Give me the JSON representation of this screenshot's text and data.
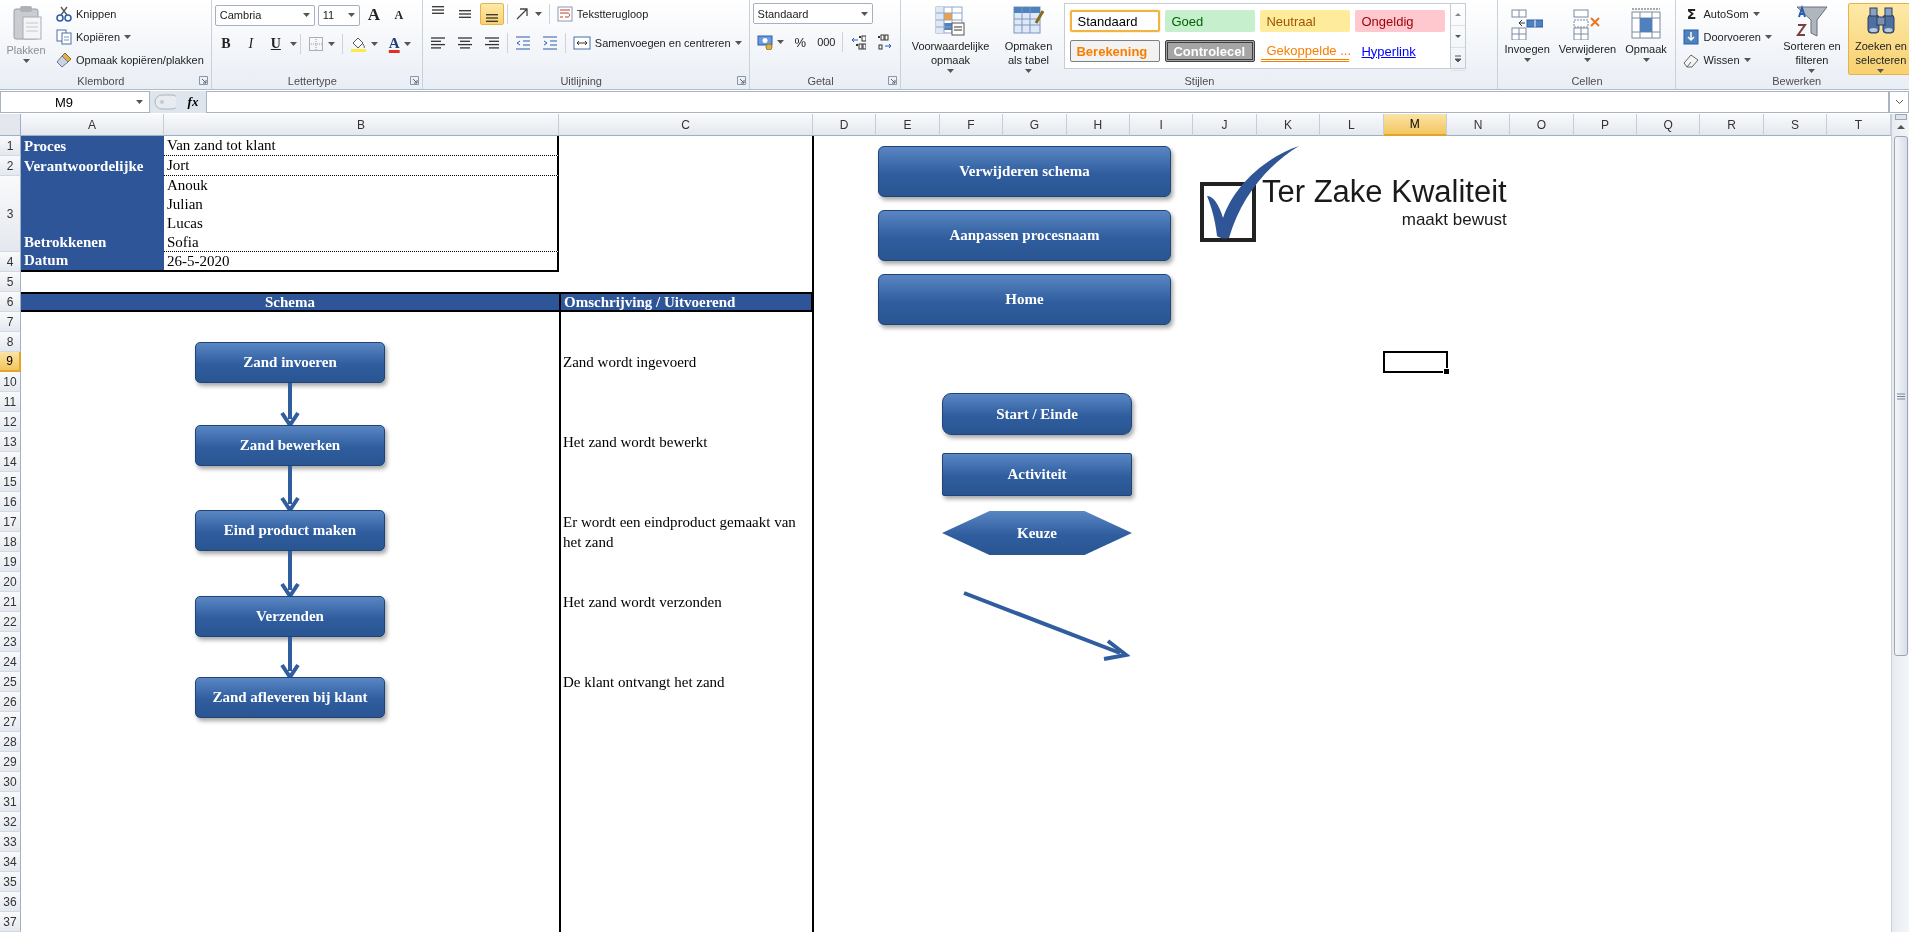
{
  "ribbon": {
    "groups": [
      {
        "kind": "clipboard",
        "label": "Klembord",
        "paste": "Plakken",
        "items": [
          "Knippen",
          "Kopiëren",
          "Opmaak kopiëren/plakken"
        ]
      },
      {
        "kind": "font",
        "label": "Lettertype",
        "font": "Cambria",
        "size": "11",
        "grow": "A",
        "shrink": "A",
        "styles": [
          "B",
          "I",
          "U"
        ],
        "font_color": "A"
      },
      {
        "kind": "alignment",
        "label": "Uitlijning",
        "vertical": [
          {
            "selected": false
          },
          {
            "selected": false
          },
          {
            "selected": true
          }
        ],
        "wrap": "Tekstterugloop",
        "merge": "Samenvoegen en centreren"
      },
      {
        "kind": "number",
        "label": "Getal",
        "format": "Standaard",
        "percent": "%",
        "thousands": "000"
      },
      {
        "kind": "styles",
        "label": "Stijlen",
        "buttons": [
          "Voorwaardelijke opmaak",
          "Opmaken als tabel"
        ],
        "cell_styles": [
          {
            "label": "Standaard",
            "kind": "normal",
            "selected": true
          },
          {
            "label": "Goed",
            "kind": "good",
            "selected": false
          },
          {
            "label": "Neutraal",
            "kind": "neutral",
            "selected": false
          },
          {
            "label": "Ongeldig",
            "kind": "bad",
            "selected": false
          },
          {
            "label": "Berekening",
            "kind": "calculation",
            "selected": false
          },
          {
            "label": "Controlecel",
            "kind": "check",
            "selected": false
          },
          {
            "label": "Gekoppelde ...",
            "kind": "linked",
            "selected": false
          },
          {
            "label": "Hyperlink",
            "kind": "hyperlink",
            "selected": false
          }
        ]
      },
      {
        "kind": "cells",
        "label": "Cellen",
        "buttons": [
          "Invoegen",
          "Verwijderen",
          "Opmaak"
        ]
      },
      {
        "kind": "editing",
        "label": "Bewerken",
        "items": [
          {
            "icon": "Σ",
            "label": "AutoSom"
          },
          {
            "label": "Doorvoeren"
          },
          {
            "label": "Wissen"
          }
        ],
        "buttons": [
          {
            "label": "Sorteren en filteren",
            "highlighted": false
          },
          {
            "label": "Zoeken en selecteren",
            "highlighted": true
          }
        ]
      }
    ]
  },
  "formula_bar": {
    "name_box": "M9",
    "fx": "fx"
  },
  "columns": [
    {
      "label": "A",
      "selected": false
    },
    {
      "label": "B",
      "selected": false
    },
    {
      "label": "C",
      "selected": false
    },
    {
      "label": "D",
      "selected": false
    },
    {
      "label": "E",
      "selected": false
    },
    {
      "label": "F",
      "selected": false
    },
    {
      "label": "G",
      "selected": false
    },
    {
      "label": "H",
      "selected": false
    },
    {
      "label": "I",
      "selected": false
    },
    {
      "label": "J",
      "selected": false
    },
    {
      "label": "K",
      "selected": false
    },
    {
      "label": "L",
      "selected": false
    },
    {
      "label": "M",
      "selected": true
    },
    {
      "label": "N",
      "selected": false
    },
    {
      "label": "O",
      "selected": false
    },
    {
      "label": "P",
      "selected": false
    },
    {
      "label": "Q",
      "selected": false
    },
    {
      "label": "R",
      "selected": false
    },
    {
      "label": "S",
      "selected": false
    },
    {
      "label": "T",
      "selected": false
    }
  ],
  "rows": [
    {
      "label": "1",
      "selected": false
    },
    {
      "label": "2",
      "selected": false
    },
    {
      "label": "3",
      "selected": false
    },
    {
      "label": "4",
      "selected": false
    },
    {
      "label": "5",
      "selected": false
    },
    {
      "label": "6",
      "selected": false
    },
    {
      "label": "7",
      "selected": false
    },
    {
      "label": "8",
      "selected": false
    },
    {
      "label": "9",
      "selected": true
    },
    {
      "label": "10",
      "selected": false
    },
    {
      "label": "11",
      "selected": false
    },
    {
      "label": "12",
      "selected": false
    },
    {
      "label": "13",
      "selected": false
    },
    {
      "label": "14",
      "selected": false
    },
    {
      "label": "15",
      "selected": false
    },
    {
      "label": "16",
      "selected": false
    },
    {
      "label": "17",
      "selected": false
    },
    {
      "label": "18",
      "selected": false
    },
    {
      "label": "19",
      "selected": false
    },
    {
      "label": "20",
      "selected": false
    },
    {
      "label": "21",
      "selected": false
    },
    {
      "label": "22",
      "selected": false
    },
    {
      "label": "23",
      "selected": false
    },
    {
      "label": "24",
      "selected": false
    },
    {
      "label": "25",
      "selected": false
    },
    {
      "label": "26",
      "selected": false
    },
    {
      "label": "27",
      "selected": false
    },
    {
      "label": "28",
      "selected": false
    },
    {
      "label": "29",
      "selected": false
    },
    {
      "label": "30",
      "selected": false
    },
    {
      "label": "31",
      "selected": false
    },
    {
      "label": "32",
      "selected": false
    },
    {
      "label": "33",
      "selected": false
    },
    {
      "label": "34",
      "selected": false
    },
    {
      "label": "35",
      "selected": false
    },
    {
      "label": "36",
      "selected": false
    },
    {
      "label": "37",
      "selected": false
    }
  ],
  "info": [
    {
      "label": "Proces",
      "values": [
        "Van zand tot klant"
      ]
    },
    {
      "label": "Verantwoordelijke",
      "values": [
        "Jort"
      ]
    },
    {
      "label": "Betrokkenen",
      "values": [
        "Anouk",
        "Julian",
        "Lucas",
        "Sofia"
      ]
    },
    {
      "label": "Datum",
      "values": [
        "26-5-2020"
      ]
    }
  ],
  "schema": {
    "title": "Schema",
    "description_title": "Omschrijving / Uitvoerend",
    "steps": [
      {
        "label": "Zand invoeren",
        "description": "Zand wordt ingevoerd"
      },
      {
        "label": "Zand bewerken",
        "description": "Het zand wordt bewerkt"
      },
      {
        "label": "Eind product maken",
        "description": "Er wordt een eindproduct gemaakt van het zand"
      },
      {
        "label": "Verzenden",
        "description": "Het zand wordt verzonden"
      },
      {
        "label": "Zand afleveren bij klant",
        "description": "De klant ontvangt het zand"
      }
    ]
  },
  "macro_buttons": [
    "Verwijderen schema",
    "Aanpassen procesnaam",
    "Home"
  ],
  "legend": [
    {
      "kind": "terminal",
      "label": "Start / Einde"
    },
    {
      "kind": "process",
      "label": "Activiteit"
    },
    {
      "kind": "decision",
      "label": "Keuze"
    },
    {
      "kind": "arrow"
    }
  ],
  "logo": {
    "title": "Ter Zake Kwaliteit",
    "tagline": "maakt bewust"
  }
}
